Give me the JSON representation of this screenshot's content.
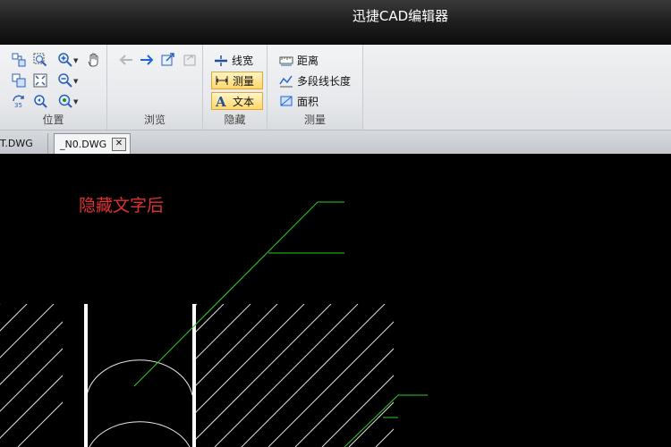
{
  "app": {
    "title": "迅捷CAD编辑器"
  },
  "ribbon": {
    "groups": [
      {
        "id": "position",
        "label": "位置"
      },
      {
        "id": "browse",
        "label": "浏览"
      },
      {
        "id": "hide",
        "label": "隐藏"
      },
      {
        "id": "measure",
        "label": "测量"
      }
    ],
    "hide_buttons": [
      {
        "label": "线宽",
        "active": false,
        "icon": "lineweight-icon"
      },
      {
        "label": "测量",
        "active": true,
        "icon": "measure-icon"
      },
      {
        "label": "文本",
        "active": true,
        "icon": "text-icon"
      }
    ],
    "measure_buttons": [
      {
        "label": "距离",
        "icon": "distance-icon"
      },
      {
        "label": "多段线长度",
        "icon": "polyline-length-icon"
      },
      {
        "label": "面积",
        "icon": "area-icon"
      }
    ],
    "icons": {
      "position": [
        "pan-window-icon",
        "zoom-window-icon",
        "zoom-in-icon",
        "hand-pan-icon",
        "copy-view-icon",
        "zoom-extents-icon",
        "zoom-out-icon",
        "rotate-3d-icon",
        "zoom-previous-icon",
        "zoom-realtime-icon"
      ],
      "browse": [
        "back-arrow-icon",
        "forward-arrow-icon",
        "export-icon",
        "print-icon"
      ]
    }
  },
  "tabs": [
    {
      "label": "T.DWG",
      "active": false
    },
    {
      "label": "_N0.DWG",
      "active": true,
      "close": "✕"
    }
  ],
  "canvas": {
    "note": "隐藏文字后",
    "note_color": "#e03030",
    "leader_color": "#2ecc2e",
    "background": "#000000"
  }
}
